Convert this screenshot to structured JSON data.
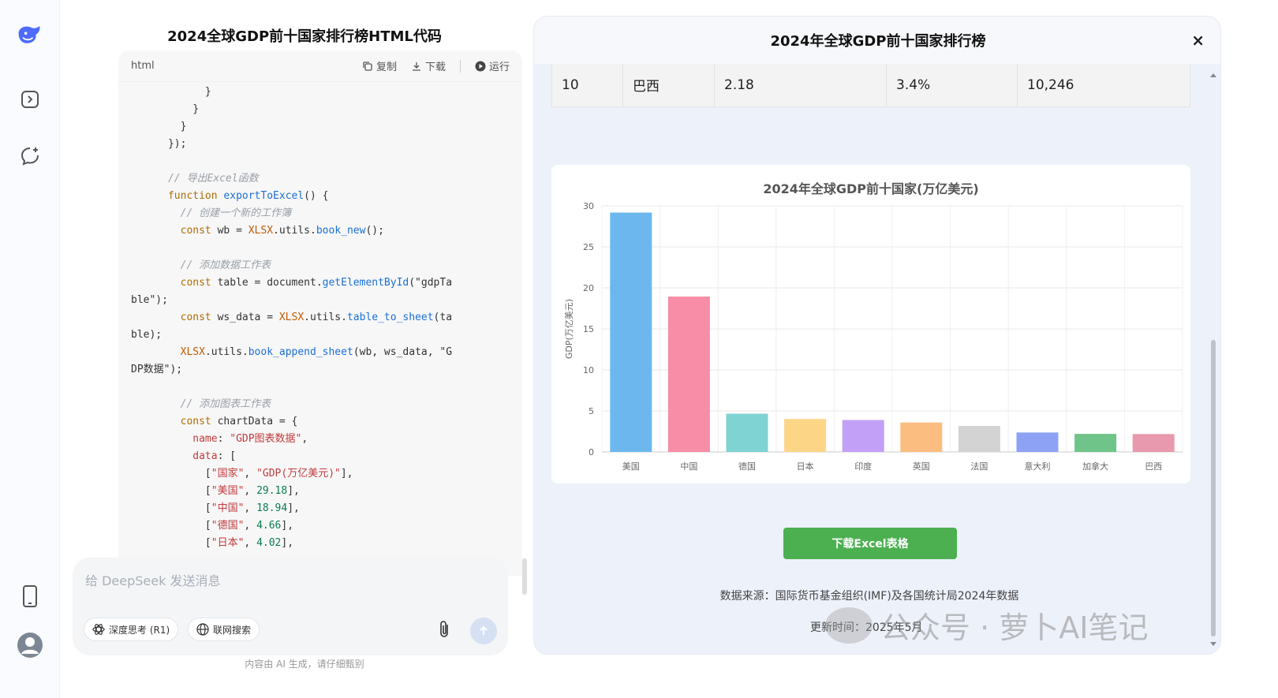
{
  "sidebar": {
    "icons": [
      "deepseek-logo",
      "sidebar-toggle-icon",
      "new-chat-icon",
      "phone-icon",
      "user-avatar-icon"
    ]
  },
  "code_panel": {
    "title": "2024全球GDP前十国家排行榜HTML代码",
    "lang": "html",
    "copy_label": "复制",
    "download_label": "下载",
    "run_label": "运行",
    "lines": [
      "            }",
      "          }",
      "        }",
      "      });",
      "",
      "      // 导出Excel函数",
      "      function exportToExcel() {",
      "        // 创建一个新的工作簿",
      "        const wb = XLSX.utils.book_new();",
      "",
      "        // 添加数据工作表",
      "        const table = document.getElementById(\"gdpTa",
      "ble\");",
      "        const ws_data = XLSX.utils.table_to_sheet(ta",
      "ble);",
      "        XLSX.utils.book_append_sheet(wb, ws_data, \"G",
      "DP数据\");",
      "",
      "        // 添加图表工作表",
      "        const chartData = {",
      "          name: \"GDP图表数据\",",
      "          data: [",
      "            [\"国家\", \"GDP(万亿美元)\"],",
      "            [\"美国\", 29.18],",
      "            [\"中国\", 18.94],",
      "            [\"德国\", 4.66],",
      "            [\"日本\", 4.02],"
    ]
  },
  "chat": {
    "placeholder": "给 DeepSeek 发送消息",
    "deep_think_label": "深度思考 (R1)",
    "web_search_label": "联网搜索",
    "footnote": "内容由 AI 生成，请仔细甄别"
  },
  "preview": {
    "title": "2024年全球GDP前十国家排行榜",
    "close": "×",
    "table_row": [
      "10",
      "巴西",
      "2.18",
      "3.4%",
      "10,246"
    ],
    "download_button": "下载Excel表格",
    "source": "数据来源：国际货币基金组织(IMF)及各国统计局2024年数据",
    "update_prefix": "更新时间：2025年5月"
  },
  "watermark": "公众号 · 萝卜AI笔记",
  "chart_data": {
    "type": "bar",
    "title": "2024年全球GDP前十国家(万亿美元)",
    "ylabel": "GDP(万亿美元)",
    "xlabel": "",
    "categories": [
      "美国",
      "中国",
      "德国",
      "日本",
      "印度",
      "英国",
      "法国",
      "意大利",
      "加拿大",
      "巴西"
    ],
    "values": [
      29.18,
      18.94,
      4.66,
      4.02,
      3.89,
      3.59,
      3.17,
      2.37,
      2.2,
      2.18
    ],
    "colors": [
      "#6cb8ee",
      "#f78da7",
      "#7fd3d3",
      "#fdd587",
      "#c3a0f7",
      "#fbbd80",
      "#d3d3d3",
      "#8ea2f5",
      "#6fc48a",
      "#e899ad"
    ],
    "ylim": [
      0,
      30
    ],
    "yticks": [
      0,
      5,
      10,
      15,
      20,
      25,
      30
    ],
    "grid": true
  }
}
